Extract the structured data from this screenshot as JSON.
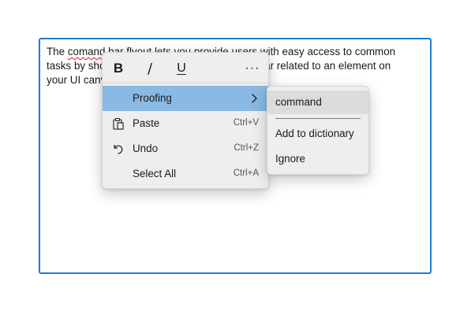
{
  "textbox": {
    "misspelled_word": "comand",
    "line1_before": "The ",
    "line1_after": " bar flyout lets you provide users with easy access to common",
    "line2": "tasks by showing commands in a floating toolbar related to an element on",
    "line3": "your UI canvas."
  },
  "commandbar": {
    "bold_label": "B",
    "italic_label": "/",
    "underline_label": "U",
    "more_label": "···"
  },
  "menu": {
    "items": [
      {
        "label": "Proofing",
        "accelerator": "",
        "icon": "chevron-right-icon"
      },
      {
        "label": "Paste",
        "accelerator": "Ctrl+V",
        "icon": "paste-icon"
      },
      {
        "label": "Undo",
        "accelerator": "Ctrl+Z",
        "icon": "undo-icon"
      },
      {
        "label": "Select All",
        "accelerator": "Ctrl+A",
        "icon": ""
      }
    ]
  },
  "submenu": {
    "items": [
      {
        "label": "command"
      },
      {
        "label": "Add to dictionary"
      },
      {
        "label": "Ignore"
      }
    ]
  },
  "colors": {
    "accent_border": "#1d7bd4",
    "selected_item": "#8ab9e3",
    "spelling_underline": "#e81123"
  }
}
